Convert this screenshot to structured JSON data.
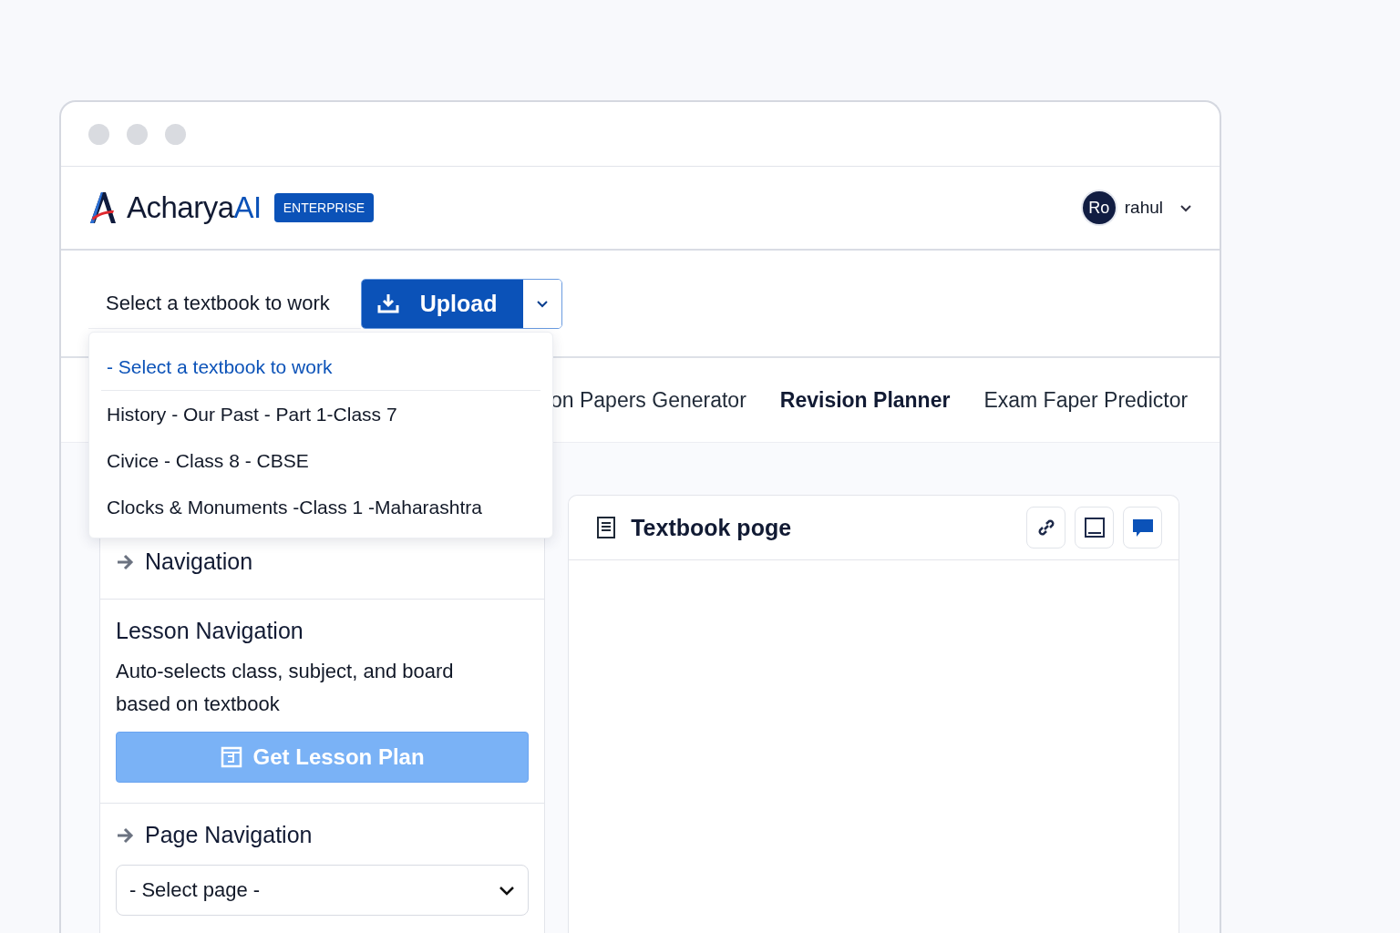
{
  "header": {
    "brand": {
      "name": "Acharya",
      "accent": "AI"
    },
    "badge": "ENTERPRISE",
    "user": {
      "initials": "Ro",
      "name": "rahul"
    }
  },
  "toolbar": {
    "textbook_label": "Select a textbook to work",
    "upload_button": "Upload"
  },
  "textbook_dropdown": {
    "open": true,
    "items": [
      {
        "label": "- Select a textbook to work",
        "selected": true
      },
      {
        "label": "History - Our Past - Part 1-Class 7",
        "selected": false
      },
      {
        "label": "Civice - Class 8 - CBSE",
        "selected": false
      },
      {
        "label": "Clocks & Monuments -Class 1 -Maharashtra",
        "selected": false
      }
    ]
  },
  "tabs": [
    {
      "label": "on Papers Generator",
      "selected": false
    },
    {
      "label": "Revision Planner",
      "selected": true
    },
    {
      "label": "Exam Faper Predictor",
      "selected": false
    }
  ],
  "left_panel": {
    "navigation": "Navigation",
    "lesson": {
      "title": "Lesson Navigation",
      "description": "Auto-selects class, subject, and board based on textbook",
      "button": {
        "label": "Get Lesson Plan",
        "disabled": true
      }
    },
    "page": {
      "title": "Page Navigation",
      "select_placeholder": "- Select page -"
    }
  },
  "textbook_page": {
    "title": "Textbook poge"
  }
}
